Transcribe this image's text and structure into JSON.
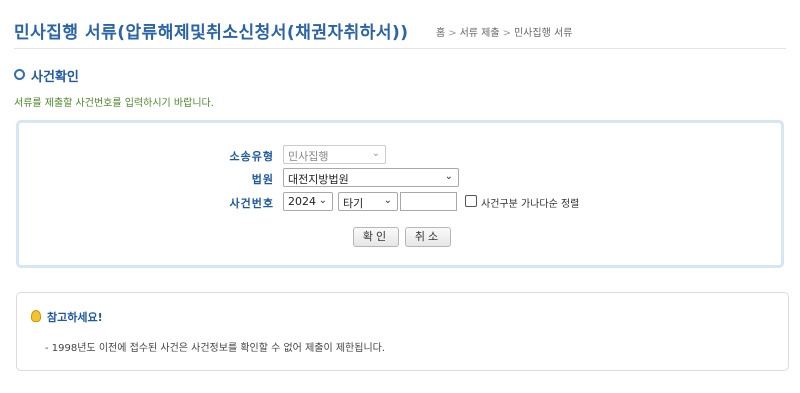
{
  "header": {
    "title": "민사집행 서류(압류해제및취소신청서(채권자취하서))",
    "breadcrumb": {
      "home": "홈",
      "separator": ">",
      "level1": "서류 제출",
      "level2": "민사집행 서류"
    }
  },
  "section": {
    "title": "사건확인",
    "instruction": "서류를 제출할 사건번호를 입력하시기 바랍니다."
  },
  "form": {
    "case_type": {
      "label": "소송유형",
      "value": "민사집행"
    },
    "court": {
      "label": "법원",
      "value": "대전지방법원"
    },
    "case_number": {
      "label": "사건번호",
      "year": "2024",
      "type": "타기",
      "number": "",
      "checkbox_label": "사건구분 가나다순 정렬",
      "checkbox_checked": false
    },
    "confirm_label": "확인",
    "cancel_label": "취소"
  },
  "notice": {
    "title": "참고하세요!",
    "text": "- 1998년도 이전에 접수된 사건은 사건정보를 확인할 수 없어 제출이 제한됩니다."
  },
  "colors": {
    "title_blue": "#2a64a8",
    "label_blue": "#1f5aa0",
    "instruction_green": "#4c8a2a",
    "form_border": "#d7e6f3"
  }
}
